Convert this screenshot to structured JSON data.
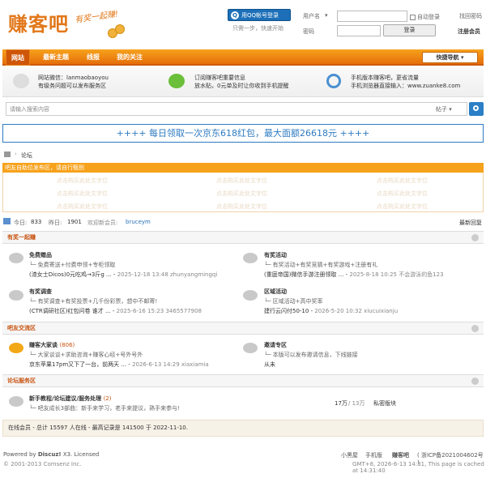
{
  "header": {
    "logo": "赚客吧",
    "slogan": "有奖一起赚!",
    "qq_login": "用QQ帐号登录",
    "qq_sub": "只需一步，快速开始",
    "username_label": "用户名",
    "password_label": "密码",
    "remember": "自动登录",
    "find_pw": "找回密码",
    "login_btn": "登录",
    "register": "注册会员",
    "username_select": "▾"
  },
  "nav": {
    "items": [
      "网站",
      "最新主题",
      "线报",
      "我的关注"
    ],
    "quick": "快捷导航"
  },
  "info": {
    "wechat_line1": "网站微信：lanmaobaoyou",
    "wechat_line2": "有级务问题可以发布服务区",
    "sub_line1": "订阅赚客吧重要信息",
    "sub_line2": "放水贴，0元单及时让你收到手机提醒",
    "mobile_line1": "手机版本赚客吧，更省流量",
    "mobile_line2": "手机浏览器直接输入：www.zuanke8.com"
  },
  "search": {
    "placeholder": "请输入搜索内容",
    "scope": "帖子"
  },
  "banner": "++++  每日领取一次京东618红包，最大面额26618元  ++++",
  "breadcrumb": "论坛",
  "ad": {
    "title": "吧友自助位发布区，请自行甄别",
    "placeholder": "点击购买此处文字位"
  },
  "stats": {
    "today_label": "今日:",
    "today": "833",
    "yesterday_label": "昨日:",
    "yesterday": "1901",
    "welcome": "欢迎新会员:",
    "new_member": "bruceym",
    "latest_reply": "最新回复"
  },
  "sections": [
    {
      "title": "有奖一起赚",
      "forums": [
        {
          "name": "免费赠品",
          "desc": "免费寄送+付费申领+专柜领取",
          "last_title": "(渣女士Dicos)0元吃鸡→3斤g ...",
          "last_meta": "2025-12-18 13:48 zhunyangmingqi"
        },
        {
          "name": "有奖活动",
          "desc": "有奖活动+有奖竞猜+有奖游戏+注册有礼",
          "last_title": "(重庭帝国)微信手游注册领取 ...",
          "last_meta": "2025-8-18 10:25 不会游泳的鱼123"
        },
        {
          "name": "有奖调查",
          "desc": "有奖调查+有奖投票+几千份彩票，想中不邮寄!",
          "last_title": "(CTR调研社区)红包问卷 谁才 ...",
          "last_meta": "2025-6-16 15:23 3465577908"
        },
        {
          "name": "区域活动",
          "desc": "区域活动+高中奖率",
          "last_title": "建行云闪付50-10",
          "last_meta": "2026-5-20 10:32 xiucuixianju"
        }
      ]
    },
    {
      "title": "吧友交流区",
      "forums": [
        {
          "name": "赚客大家谈",
          "count": "(806)",
          "desc": "大家谈谈+求助咨询+赚客心经+号外号外",
          "last_title": "京东苹果17pm又下了一台，前两天 ...",
          "last_meta": "2026-6-13 14:29 xiaxiamia"
        },
        {
          "name": "邀请专区",
          "desc": "本版可以发布邀请信息，下线链接",
          "last_title": "从未",
          "last_meta": ""
        }
      ]
    },
    {
      "title": "论坛服务区",
      "forums": [
        {
          "name": "新手教程/论坛建议/服务处理",
          "count": "(2)",
          "desc": "吧友成长3部曲：新手来学习，老手来提议，熟手来参与!",
          "threads": "17万",
          "posts": "13万",
          "last_title": "私密版块"
        }
      ]
    }
  ],
  "online": "在线会员 - 总计 15597 人在线 - 最高记录是 141500 于 2022-11-10.",
  "footer": {
    "powered": "Powered by",
    "discuz": "Discuz!",
    "version": "X3. Licensed",
    "copyright": "© 2001-2013 Comsenz Inc.",
    "links": [
      "小黑屋",
      "手机版",
      "赚客吧",
      "( 浙ICP备2021004602号 )"
    ],
    "gmt": "GMT+8, 2026-6-13 14:31, This page is cached at 14:31:40"
  },
  "colors": {
    "accent": "#e56e0a",
    "blue": "#2b7fc6"
  }
}
